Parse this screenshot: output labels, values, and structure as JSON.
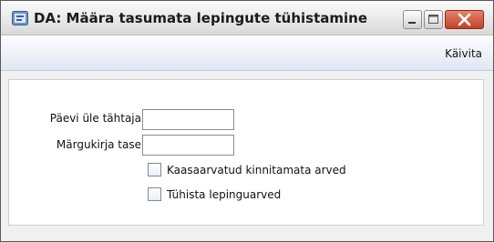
{
  "window": {
    "title": "DA: Määra tasumata lepingute tühistamine"
  },
  "toolbar": {
    "run_label": "Käivita"
  },
  "form": {
    "days_overdue_label": "Päevi üle tähtaja",
    "days_overdue_value": "",
    "reminder_level_label": "Märgukirja tase",
    "reminder_level_value": "",
    "include_unapproved_label": "Kaasaarvatud  kinnitamata arved",
    "include_unapproved_checked": false,
    "cancel_contract_invoices_label": "Tühista lepinguarved",
    "cancel_contract_invoices_checked": false
  },
  "colors": {
    "close_button": "#c94a32",
    "toolbar_gradient_bottom": "#e2e6f3"
  }
}
